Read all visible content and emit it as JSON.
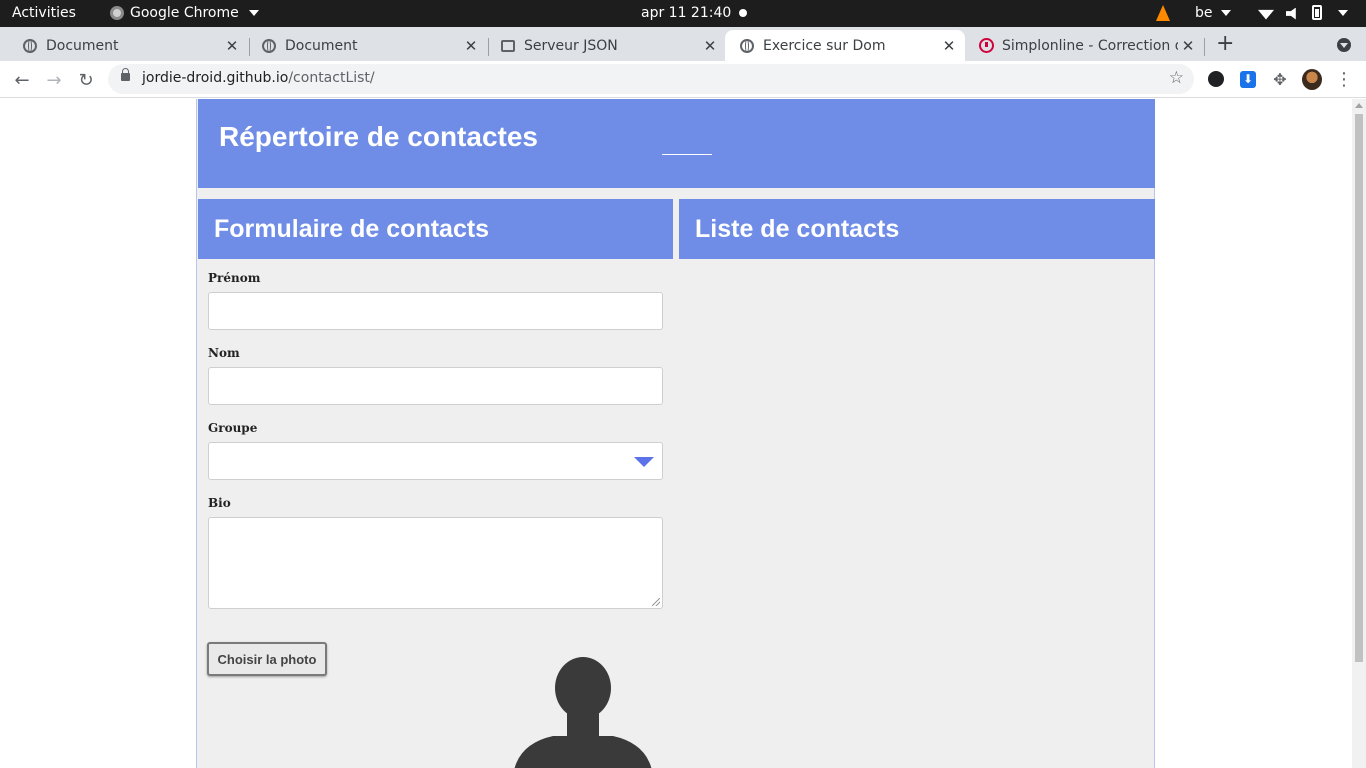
{
  "topbar": {
    "activities": "Activities",
    "app_name": "Google Chrome",
    "clock": "apr 11  21:40",
    "keyboard_layout": "be"
  },
  "tabs": [
    {
      "title": "Document",
      "icon": "globe-icon",
      "active": false
    },
    {
      "title": "Document",
      "icon": "globe-icon",
      "active": false
    },
    {
      "title": "Serveur JSON",
      "icon": "json-icon",
      "active": false
    },
    {
      "title": "Exercice sur Dom",
      "icon": "globe-icon",
      "active": true
    },
    {
      "title": "Simplonline - Correction d",
      "icon": "simplon-icon",
      "active": false
    }
  ],
  "toolbar": {
    "url_host": "jordie-droid.github.io",
    "url_path": "/contactList/"
  },
  "page": {
    "title": "Répertoire de contactes",
    "form_title": "Formulaire de contacts",
    "list_title": "Liste de contacts",
    "fields": {
      "prenom_label": "Prénom",
      "prenom_value": "",
      "nom_label": "Nom",
      "nom_value": "",
      "groupe_label": "Groupe",
      "groupe_value": "",
      "bio_label": "Bio",
      "bio_value": ""
    },
    "photo_button": "Choisir la photo"
  },
  "colors": {
    "accent": "#6f8de6",
    "panel_bg": "#efefef",
    "select_arrow": "#5b72e8"
  }
}
